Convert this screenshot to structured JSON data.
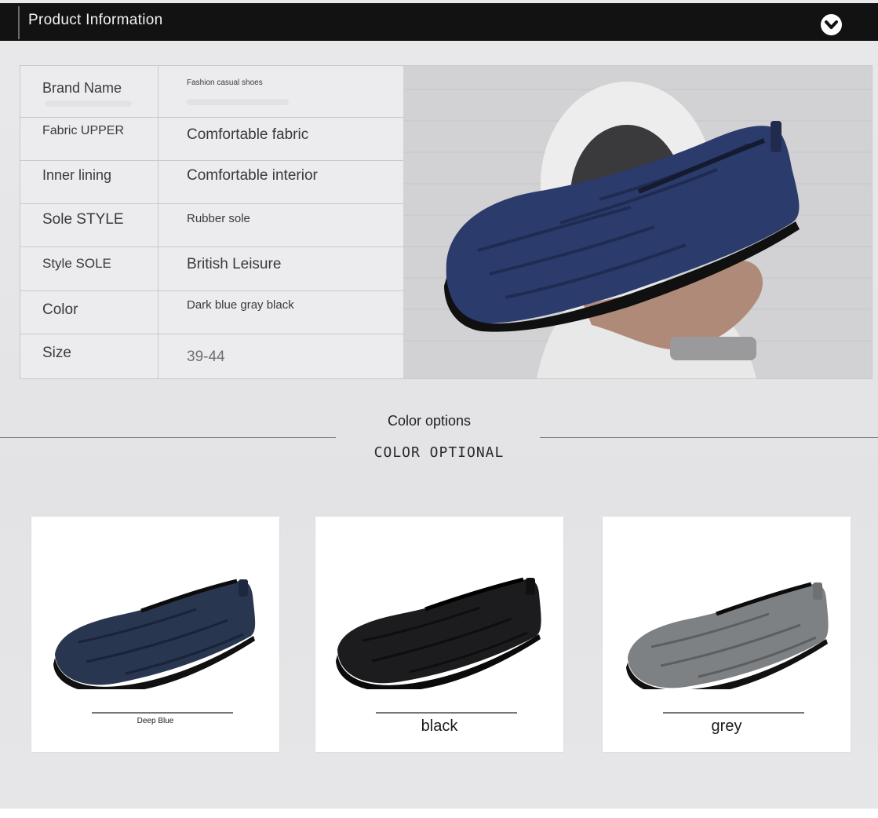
{
  "header": {
    "title": "Product Information",
    "toggle_icon": "chevron-down-circle-icon"
  },
  "specs": [
    {
      "label": "Brand Name",
      "value": "Fashion casual shoes"
    },
    {
      "label": "Fabric UPPER",
      "value": "Comfortable fabric"
    },
    {
      "label": "Inner lining",
      "value": "Comfortable interior"
    },
    {
      "label": "Sole STYLE",
      "value": "Rubber sole"
    },
    {
      "label": "Style SOLE",
      "value": "British Leisure"
    },
    {
      "label": "Color",
      "value": "Dark blue gray black"
    },
    {
      "label": "Size",
      "value": "39-44"
    }
  ],
  "colors_section": {
    "title": "Color options",
    "subtitle": "COLOR OPTIONAL"
  },
  "variants": [
    {
      "name": "Deep Blue",
      "shoe_color": "#283650",
      "shoe_dark": "#1a2338"
    },
    {
      "name": "black",
      "shoe_color": "#1c1c1e",
      "shoe_dark": "#0e0e0f"
    },
    {
      "name": "grey",
      "shoe_color": "#7e8184",
      "shoe_dark": "#5c5f62"
    }
  ],
  "colors": {
    "header_bg": "#121212",
    "page_bg": "#e6e6e8",
    "text": "#3a3a3a"
  }
}
